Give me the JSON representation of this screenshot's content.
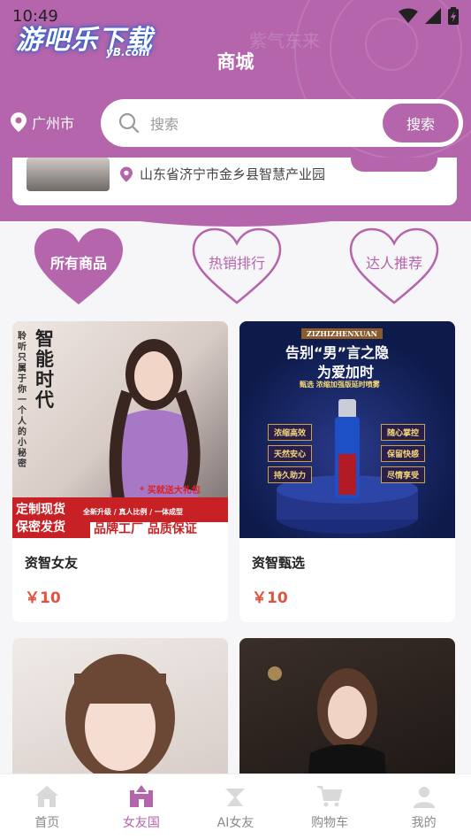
{
  "status_bar": {
    "time": "10:49"
  },
  "watermark": {
    "title": "游吧乐下载",
    "sub": "yB.com"
  },
  "header": {
    "title": "商城",
    "script_text": "紫气东来"
  },
  "location": {
    "city": "广州市"
  },
  "search": {
    "placeholder": "搜索",
    "button_label": "搜索"
  },
  "store": {
    "address": "山东省济宁市金乡县智慧产业园"
  },
  "categories": [
    {
      "label": "所有商品",
      "active": true
    },
    {
      "label": "热销排行",
      "active": false
    },
    {
      "label": "达人推荐",
      "active": false
    }
  ],
  "products": [
    {
      "name": "资智女友",
      "price": "￥10",
      "art": {
        "big": "智能时代",
        "side": "聆听只属于你一个人的小秘密",
        "gift": "* 买就送大礼包",
        "banner_left": "定制现货\n保密发货",
        "banner_top": "全新升级 / 真人比例 / 一体成型",
        "banner_bottom": "品牌工厂 品质保证"
      }
    },
    {
      "name": "资智甄选",
      "price": "￥10",
      "art": {
        "brand": "ZIZHIZHENXUAN",
        "headline1": "告别“男”言之隐",
        "headline2": "为爱加时",
        "tag": "甄选 浓缩加强版延时喷雾",
        "features": [
          "浓缩高效",
          "随心掌控",
          "天然安心",
          "保留快感",
          "持久助力",
          "尽情享受"
        ]
      }
    },
    {
      "name": "",
      "price": ""
    },
    {
      "name": "",
      "price": ""
    }
  ],
  "bottom_nav": [
    {
      "label": "首页",
      "icon": "home-icon",
      "active": false
    },
    {
      "label": "女友国",
      "icon": "castle-icon",
      "active": true
    },
    {
      "label": "AI女友",
      "icon": "ai-icon",
      "active": false
    },
    {
      "label": "购物车",
      "icon": "cart-icon",
      "active": false
    },
    {
      "label": "我的",
      "icon": "user-icon",
      "active": false
    }
  ],
  "colors": {
    "accent": "#b465ab",
    "price": "#e0533f",
    "background": "#f6f5f8"
  }
}
